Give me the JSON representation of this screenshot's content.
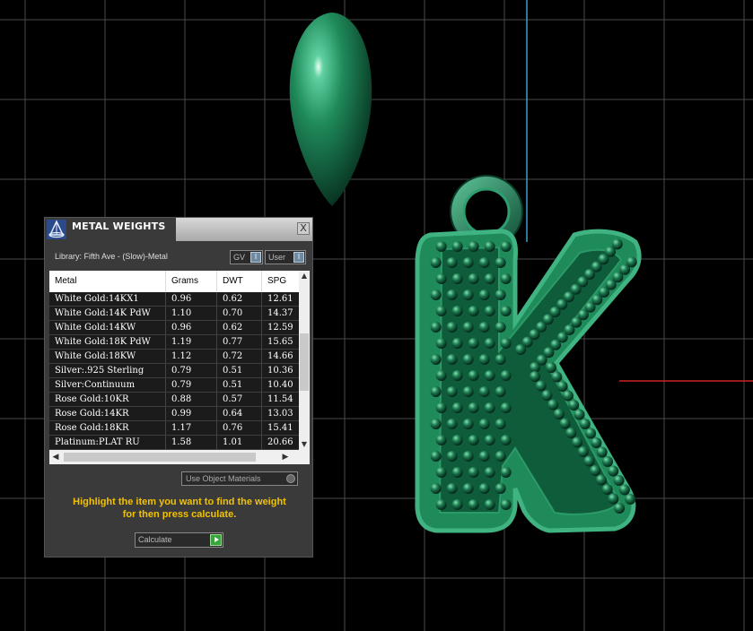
{
  "panel": {
    "title": "METAL WEIGHTS",
    "close_label": "X",
    "library_label": "Library: Fifth Ave - (Slow)-Metal",
    "gv_label": "GV",
    "user_label": "User",
    "indicator_glyph": "I",
    "use_object_materials_label": "Use Object Materials",
    "instructions_line1": "Highlight the item you want to find the weight",
    "instructions_line2": "for then press calculate.",
    "calculate_label": "Calculate"
  },
  "table": {
    "columns": [
      "Metal",
      "Grams",
      "DWT",
      "SPG"
    ],
    "rows": [
      {
        "metal": "White Gold:14KX1",
        "grams": "0.96",
        "dwt": "0.62",
        "spg": "12.61"
      },
      {
        "metal": "White Gold:14K PdW",
        "grams": "1.10",
        "dwt": "0.70",
        "spg": "14.37"
      },
      {
        "metal": "White Gold:14KW",
        "grams": "0.96",
        "dwt": "0.62",
        "spg": "12.59"
      },
      {
        "metal": "White Gold:18K PdW",
        "grams": "1.19",
        "dwt": "0.77",
        "spg": "15.65"
      },
      {
        "metal": "White Gold:18KW",
        "grams": "1.12",
        "dwt": "0.72",
        "spg": "14.66"
      },
      {
        "metal": "Silver:.925 Sterling",
        "grams": "0.79",
        "dwt": "0.51",
        "spg": "10.36"
      },
      {
        "metal": "Silver:Continuum",
        "grams": "0.79",
        "dwt": "0.51",
        "spg": "10.40"
      },
      {
        "metal": "Rose Gold:10KR",
        "grams": "0.88",
        "dwt": "0.57",
        "spg": "11.54"
      },
      {
        "metal": "Rose Gold:14KR",
        "grams": "0.99",
        "dwt": "0.64",
        "spg": "13.03"
      },
      {
        "metal": "Rose Gold:18KR",
        "grams": "1.17",
        "dwt": "0.76",
        "spg": "15.41"
      },
      {
        "metal": "Platinum:PLAT RU",
        "grams": "1.58",
        "dwt": "1.01",
        "spg": "20.66"
      }
    ]
  },
  "icons": {
    "logo": "app-logo-icon",
    "close": "close-icon",
    "scroll_up": "chevron-up-icon",
    "scroll_down": "chevron-down-icon",
    "scroll_left": "chevron-left-icon",
    "scroll_right": "chevron-right-icon",
    "calculate": "play-icon"
  },
  "colors": {
    "viewport_bg": "#000000",
    "grid": "#4a4a4a",
    "model_green": "#1f8a5a",
    "instructions": "#f2c200",
    "axis_red": "#cc2222",
    "axis_blue": "#3aa0c8"
  }
}
